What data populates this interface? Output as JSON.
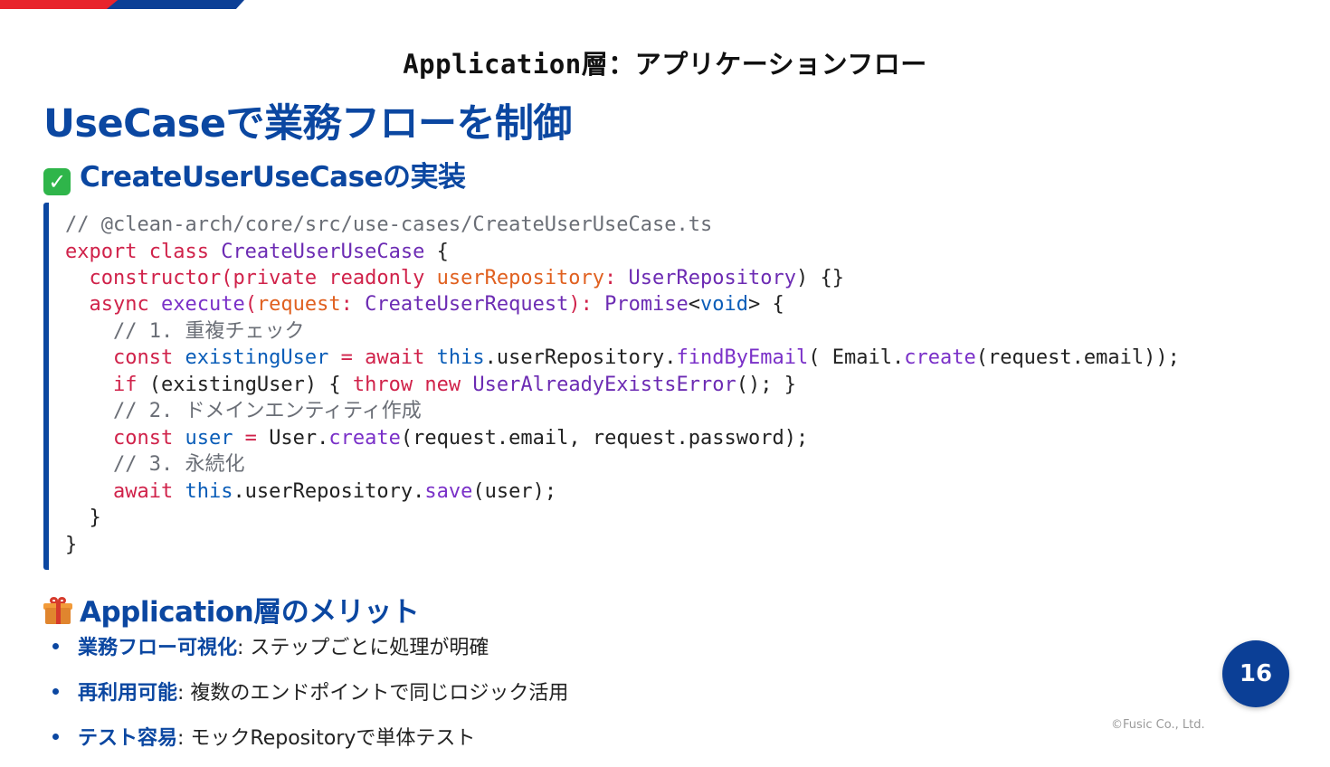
{
  "header": {
    "title": "Application層：アプリケーションフロー"
  },
  "main_title": "UseCaseで業務フローを制御",
  "section1": {
    "icon": "check-mark-icon",
    "heading": "CreateUserUseCaseの実装"
  },
  "code": {
    "l1": {
      "t1": "// @clean-arch/core/src/use-cases/CreateUserUseCase.ts"
    },
    "l2": {
      "t1": "export class ",
      "t2": "CreateUserUseCase",
      "t3": " {"
    },
    "l3": {
      "t1": "  constructor(",
      "t2": "private readonly ",
      "t3": "userRepository",
      "t4": ": ",
      "t5": "UserRepository",
      "t6": ") {}"
    },
    "l4": {
      "t1": "  async ",
      "t2": "execute",
      "t3": "(",
      "t4": "request",
      "t5": ": ",
      "t6": "CreateUserRequest",
      "t7": "): ",
      "t8": "Promise",
      "t9": "<",
      "t10": "void",
      "t11": "> {"
    },
    "l5": {
      "t1": "    // 1. 重複チェック"
    },
    "l6": {
      "t1": "    const ",
      "t2": "existingUser",
      "t3": " = ",
      "t4": "await ",
      "t5": "this",
      "t6": ".userRepository.",
      "t7": "findByEmail",
      "t8": "( Email.",
      "t9": "create",
      "t10": "(request.email));"
    },
    "l7": {
      "t1": "    if",
      "t2": " (existingUser) { ",
      "t3": "throw new ",
      "t4": "UserAlreadyExistsError",
      "t5": "(); }"
    },
    "l8": {
      "t1": "    // 2. ドメインエンティティ作成"
    },
    "l9": {
      "t1": "    const ",
      "t2": "user",
      "t3": " = ",
      "t4": "User.",
      "t5": "create",
      "t6": "(request.email, request.password);"
    },
    "l10": {
      "t1": "    // 3. 永続化"
    },
    "l11": {
      "t1": "    await ",
      "t2": "this",
      "t3": ".userRepository.",
      "t4": "save",
      "t5": "(user);"
    },
    "l12": {
      "t1": "  }"
    },
    "l13": {
      "t1": "}"
    }
  },
  "section2": {
    "icon": "gift-icon",
    "heading": "Application層のメリット"
  },
  "merits": [
    {
      "bold": "業務フロー可視化",
      "text": ": ステップごとに処理が明確"
    },
    {
      "bold": "再利用可能",
      "text": ": 複数のエンドポイントで同じロジック活用"
    },
    {
      "bold": "テスト容易",
      "text": ": モックRepositoryで単体テスト"
    }
  ],
  "page_number": "16",
  "copyright": "©Fusic Co., Ltd.",
  "colors": {
    "brand_blue": "#0b47a1",
    "accent_red": "#e8242c",
    "keyword": "#d0224a",
    "type": "#6c2bb3",
    "comment": "#6a6e76"
  }
}
